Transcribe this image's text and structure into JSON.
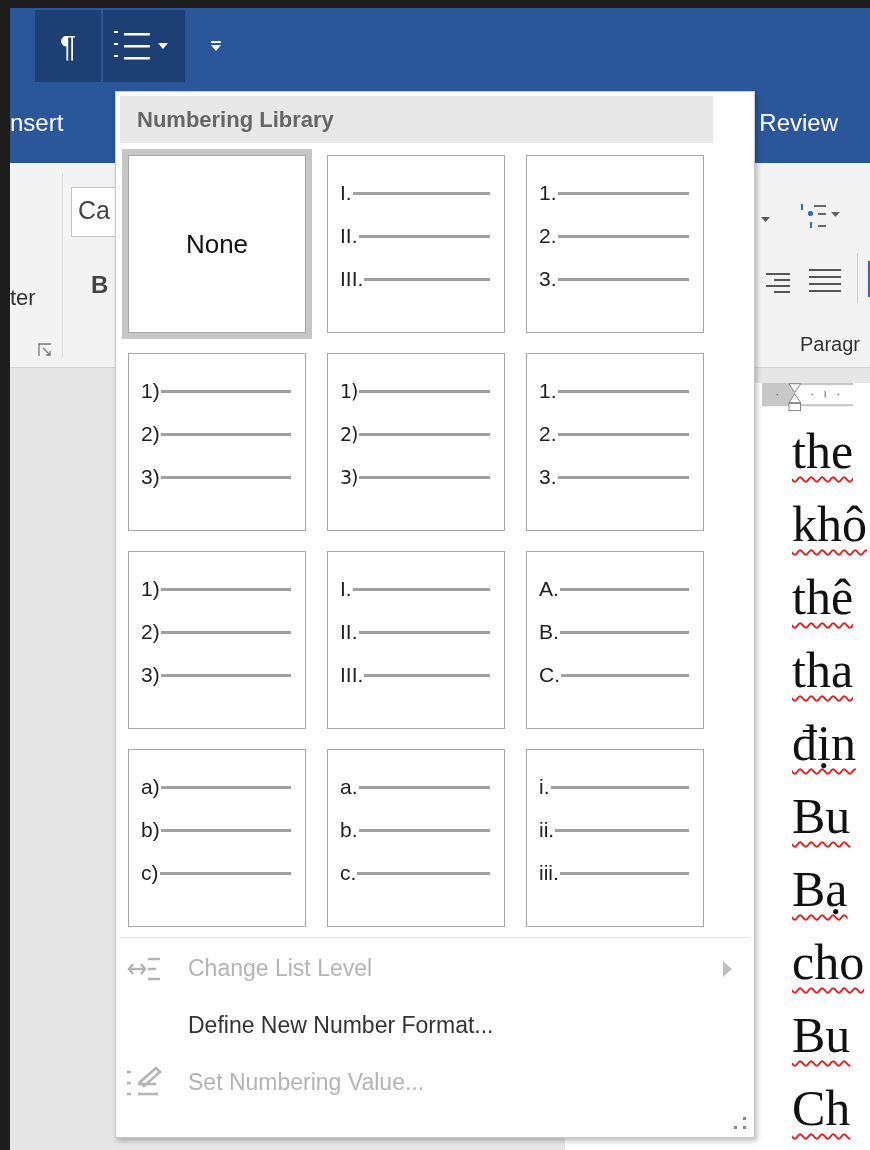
{
  "toolbar": {
    "buttons": [
      {
        "kind": "pilcrow",
        "label": "¶",
        "selected": true
      },
      {
        "kind": "numbering",
        "selected": true
      },
      {
        "kind": "overflow",
        "selected": false
      }
    ]
  },
  "ribbon_tabs": [
    {
      "label": "nsert"
    },
    {
      "label": "Review"
    }
  ],
  "ribbon": {
    "font_field": {
      "value": "Ca"
    },
    "bold_label": "B",
    "left_group_label": "ter",
    "paragraph_group_label": "Paragr"
  },
  "numbering_menu": {
    "title": "Numbering Library",
    "library": [
      {
        "kind": "none",
        "label": "None",
        "selected": true
      },
      {
        "kind": "list",
        "markers": [
          "I.",
          "II.",
          "III."
        ],
        "selected": false
      },
      {
        "kind": "list",
        "markers": [
          "1.",
          "2.",
          "3."
        ],
        "selected": false
      },
      {
        "kind": "list",
        "markers": [
          "1)",
          "2)",
          "3)"
        ],
        "selected": false
      },
      {
        "kind": "list",
        "markers": [
          "1)",
          "2)",
          "3)"
        ],
        "selected": false
      },
      {
        "kind": "list",
        "markers": [
          "1.",
          "2.",
          "3."
        ],
        "selected": false
      },
      {
        "kind": "list",
        "markers": [
          "1)",
          "2)",
          "3)"
        ],
        "selected": false
      },
      {
        "kind": "list",
        "markers": [
          "I.",
          "II.",
          "III."
        ],
        "selected": false
      },
      {
        "kind": "list",
        "markers": [
          "A.",
          "B.",
          "C."
        ],
        "selected": false
      },
      {
        "kind": "list",
        "markers": [
          "a)",
          "b)",
          "c)"
        ],
        "selected": false
      },
      {
        "kind": "list",
        "markers": [
          "a.",
          "b.",
          "c."
        ],
        "selected": false
      },
      {
        "kind": "list",
        "markers": [
          "i.",
          "ii.",
          "iii."
        ],
        "selected": false
      }
    ],
    "items": [
      {
        "kind": "level",
        "label": "Change List Level",
        "disabled": true,
        "submenu": true
      },
      {
        "kind": "define",
        "label": "Define New Number Format...",
        "disabled": false,
        "submenu": false
      },
      {
        "kind": "value",
        "label": "Set Numbering Value...",
        "disabled": true,
        "submenu": false
      }
    ]
  },
  "document": {
    "lines": [
      "the",
      "khô",
      "thê",
      "tha",
      "địn",
      "Bu",
      "Bạ",
      "cho",
      "Bu",
      "Ch"
    ]
  }
}
